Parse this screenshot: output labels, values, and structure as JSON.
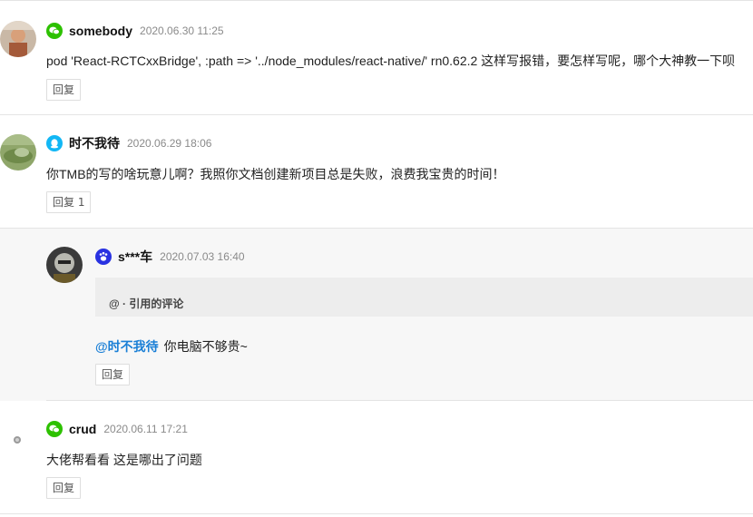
{
  "comments": [
    {
      "user": "somebody",
      "source_icon": "wechat-icon",
      "time": "2020.06.30 11:25",
      "text": "pod 'React-RCTCxxBridge', :path => '../node_modules/react-native/' rn0.62.2 这样写报错，要怎样写呢，哪个大神教一下呗",
      "reply_label": "回复"
    },
    {
      "user": "时不我待",
      "source_icon": "qq-icon",
      "time": "2020.06.29 18:06",
      "text": "你TMB的写的啥玩意儿啊？我照你文档创建新项目总是失败，浪费我宝贵的时间！",
      "reply_label": "回复 1"
    },
    {
      "user": "crud",
      "source_icon": "wechat-icon",
      "time": "2020.06.11 17:21",
      "text": "大佬帮看看 这是哪出了问题",
      "reply_label": "回复"
    }
  ],
  "reply": {
    "user": "s***车",
    "source_icon": "baidu-icon",
    "time": "2020.07.03 16:40",
    "quote": "@ · 引用的评论",
    "mention": "@时不我待",
    "text": "你电脑不够贵~",
    "reply_label": "回复"
  },
  "colors": {
    "wechat": "#2dc100",
    "qq": "#12b7f5",
    "baidu": "#2932e1",
    "mention": "#1a7fd6"
  }
}
